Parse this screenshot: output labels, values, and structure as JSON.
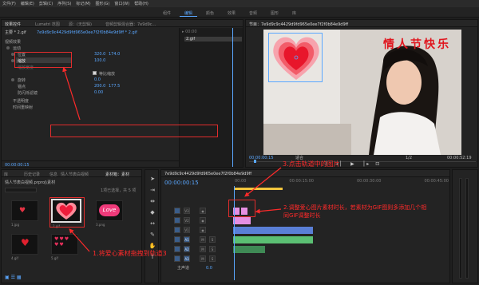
{
  "menu": [
    "文件(F)",
    "编辑(E)",
    "剪辑(C)",
    "序列(S)",
    "标记(M)",
    "图形(G)",
    "窗口(W)",
    "帮助(H)"
  ],
  "workspaces": [
    "组件",
    "编辑",
    "颜色",
    "效果",
    "音频",
    "图形",
    "库"
  ],
  "active_workspace": "编辑",
  "effect_panel": {
    "tabs": [
      "效果控件",
      "Lumetri 范围",
      "源：(无剪辑)",
      "音频剪辑混合器：7e9d9c..."
    ],
    "source_path": "主要 * 2.gif",
    "sequence_path": "7e9d9c9c4429d9fd965e0ee7f2f0b84e9d9ff * 2.gif",
    "section": "视频效果",
    "motion": "运动",
    "position_label": "位置",
    "position_x": "320.0",
    "position_y": "174.0",
    "scale_label": "缩放",
    "scale_value": "100.0",
    "scale_width_label": "缩放宽度",
    "uniform_scale_label": "等比缩放",
    "rotation_label": "旋转",
    "rotation_value": "0.0",
    "anchor_label": "锚点",
    "anchor_x": "200.0",
    "anchor_y": "177.5",
    "anti_flicker_label": "防闪烁滤镜",
    "anti_flicker_value": "0.00",
    "opacity_label": "不透明度",
    "time_remap_label": "时间重映射",
    "mini_clip": "2.gif",
    "timecode": "00:00:00:15"
  },
  "program_monitor": {
    "title": "节目：7e9d9c9c4429d9fd965e0ee7f2f0b84e9d9ff",
    "overlay_text": "情人节快乐",
    "timecode": "00:00:00:15",
    "fit": "适合",
    "quality": "1/2",
    "duration": "00:00:52:19"
  },
  "project_panel": {
    "tabs": [
      "库",
      "历史记录",
      "信息",
      "情人节表白视频",
      "素材箱：素材"
    ],
    "bin_path": "情人节表白视频.prproj\\素材",
    "count": "1项已选择，共 5 项",
    "items": [
      {
        "name": "1.jpg",
        "kind": "stars"
      },
      {
        "name": "2.gif",
        "kind": "heart-glow"
      },
      {
        "name": "3.png",
        "kind": "love-bubble"
      },
      {
        "name": "4.gif",
        "kind": "red-balloon"
      },
      {
        "name": "5.gif",
        "kind": "hearts-scatter"
      }
    ],
    "love_text": "Love"
  },
  "timeline": {
    "tab": "7e9d9c9c4429d9fd965e0ee7f2f0b84e9d9ff",
    "timecode": "00:00:00:15",
    "video_tracks": [
      "V3",
      "V2",
      "V1"
    ],
    "audio_tracks": [
      "A1",
      "A2",
      "A3"
    ],
    "master_label": "主声道",
    "master_value": "0.0",
    "ruler": [
      "00:00",
      "00:00:15:00",
      "00:00:30:00",
      "00:00:45:00"
    ]
  },
  "annotations": {
    "step1": "1.将爱心素材拖拽到轨道3",
    "step2_line1": "2.调整爱心图片素材时长，若素材为GIF图则多添加几个相",
    "step2_line2": "同GIF调整时长",
    "step3": "3.点击轨道中的图片"
  },
  "colors": {
    "accent": "#5aa7ff",
    "annotation": "#ff2a2a",
    "clip_pink": "#e58fe2",
    "clip_blue": "#5a7fd6",
    "clip_green": "#5bbf73"
  }
}
